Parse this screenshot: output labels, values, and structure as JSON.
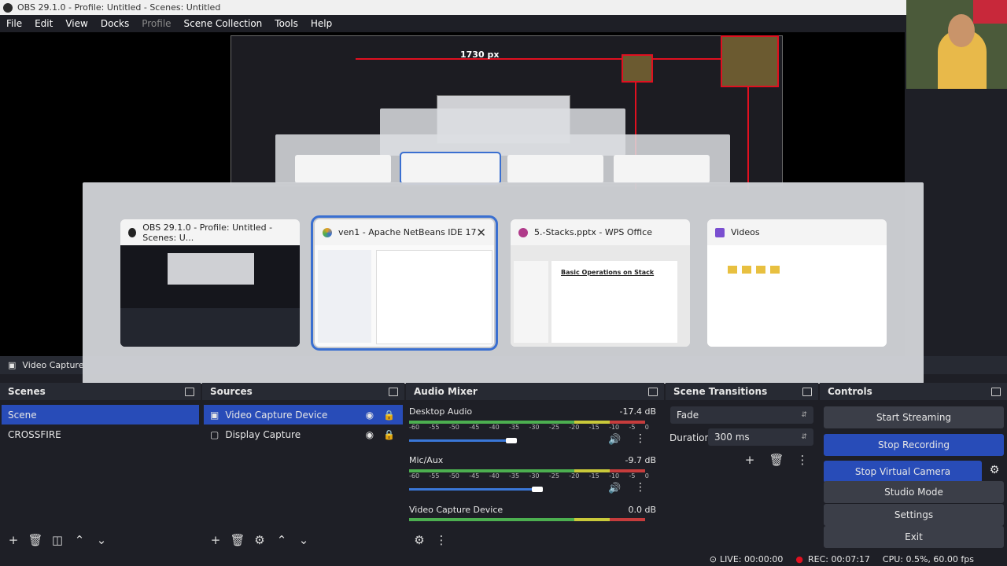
{
  "window": {
    "title": "OBS 29.1.0 - Profile: Untitled - Scenes: Untitled"
  },
  "menu": [
    "File",
    "Edit",
    "View",
    "Docks",
    "Profile",
    "Scene Collection",
    "Tools",
    "Help"
  ],
  "preview": {
    "width_label": "1730 px"
  },
  "alttab": {
    "windows": [
      {
        "title": "OBS 29.1.0 - Profile: Untitled - Scenes: U...",
        "icon": "obs-icon"
      },
      {
        "title": "ven1 - Apache NetBeans IDE 17",
        "icon": "netbeans-icon",
        "selected": true
      },
      {
        "title": "5.-Stacks.pptx - WPS Office",
        "icon": "wps-icon"
      },
      {
        "title": "Videos",
        "icon": "folder-icon"
      }
    ],
    "wps_slide_title": "Basic Operations on Stack"
  },
  "source_toolbar": {
    "label": "Video Capture"
  },
  "scenes": {
    "title": "Scenes",
    "items": [
      "Scene",
      "CROSSFIRE"
    ]
  },
  "sources": {
    "title": "Sources",
    "items": [
      "Video Capture Device",
      "Display Capture"
    ]
  },
  "mixer": {
    "title": "Audio Mixer",
    "channels": [
      {
        "name": "Desktop Audio",
        "db": "-17.4 dB"
      },
      {
        "name": "Mic/Aux",
        "db": "-9.7 dB"
      },
      {
        "name": "Video Capture Device",
        "db": "0.0 dB"
      }
    ],
    "ticks": [
      "-60",
      "-55",
      "-50",
      "-45",
      "-40",
      "-35",
      "-30",
      "-25",
      "-20",
      "-15",
      "-10",
      "-5",
      "0"
    ]
  },
  "transitions": {
    "title": "Scene Transitions",
    "type": "Fade",
    "duration_label": "Duration",
    "duration": "300 ms"
  },
  "controls": {
    "title": "Controls",
    "start_streaming": "Start Streaming",
    "stop_recording": "Stop Recording",
    "stop_virtual_camera": "Stop Virtual Camera",
    "studio_mode": "Studio Mode",
    "settings": "Settings",
    "exit": "Exit"
  },
  "status": {
    "live": "LIVE: 00:00:00",
    "rec": "REC: 00:07:17",
    "cpu": "CPU: 0.5%, 60.00 fps"
  },
  "colors": {
    "accent": "#284cb8",
    "rec_red": "#e01020"
  }
}
